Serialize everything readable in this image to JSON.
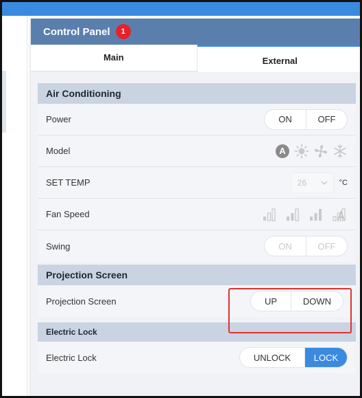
{
  "panel": {
    "title": "Control Panel",
    "badge": "1"
  },
  "tabs": [
    {
      "label": "Main"
    },
    {
      "label": "External"
    }
  ],
  "air_conditioning": {
    "header": "Air Conditioning",
    "power": {
      "label": "Power",
      "on": "ON",
      "off": "OFF"
    },
    "model": {
      "label": "Model",
      "icons": [
        "auto-mode-icon",
        "sun-icon",
        "fan-icon",
        "snowflake-icon"
      ],
      "auto_letter": "A"
    },
    "set_temp": {
      "label": "SET TEMP",
      "value": "26",
      "unit": "°C"
    },
    "fan_speed": {
      "label": "Fan Speed",
      "icons": [
        "fan-speed-low-icon",
        "fan-speed-medium-icon",
        "fan-speed-high-icon",
        "fan-speed-auto-icon"
      ]
    },
    "swing": {
      "label": "Swing",
      "on": "ON",
      "off": "OFF"
    }
  },
  "projection_screen": {
    "header": "Projection Screen",
    "row": {
      "label": "Projection Screen",
      "up": "UP",
      "down": "DOWN"
    }
  },
  "electric_lock": {
    "header": "Electric Lock",
    "row": {
      "label": "Electric Lock",
      "unlock": "UNLOCK",
      "lock": "LOCK",
      "active": "LOCK"
    }
  },
  "colors": {
    "accent": "#3a8ae0",
    "header_bar": "#5b7fad",
    "badge": "#e8202a",
    "highlight": "#e0302e"
  }
}
